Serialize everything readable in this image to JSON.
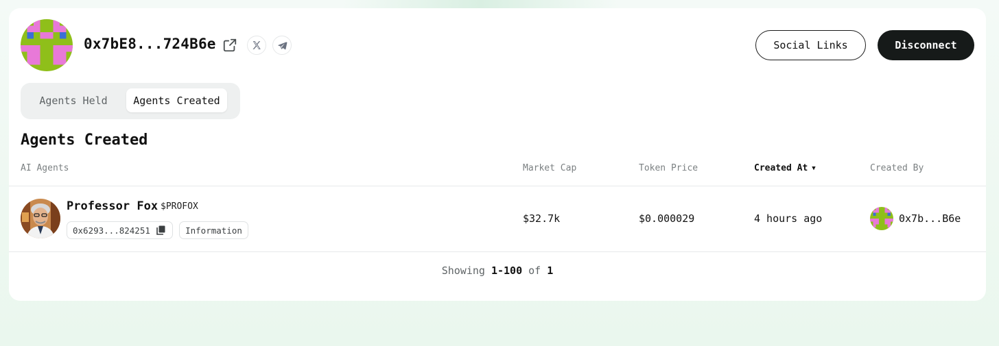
{
  "profile": {
    "address_short": "0x7bE8...724B6e",
    "avatar_colors": {
      "bg": "#8fbf1a",
      "pink": "#e879d8",
      "blue": "#3b6fd6"
    }
  },
  "header": {
    "social_links_label": "Social Links",
    "disconnect_label": "Disconnect"
  },
  "tabs": [
    {
      "label": "Agents Held",
      "active": false
    },
    {
      "label": "Agents Created",
      "active": true
    }
  ],
  "section_title": "Agents Created",
  "table": {
    "columns": [
      "AI Agents",
      "Market Cap",
      "Token Price",
      "Created At",
      "Created By"
    ],
    "sorted_column": "Created At",
    "rows": [
      {
        "name": "Professor Fox",
        "ticker": "$PROFOX",
        "contract": "0x6293...824251",
        "tag": "Information",
        "market_cap": "$32.7k",
        "token_price": "$0.000029",
        "created_at": "4 hours ago",
        "created_by": "0x7b...B6e"
      }
    ]
  },
  "pagination": {
    "prefix": "Showing",
    "range": "1-100",
    "of_label": "of",
    "total": "1"
  },
  "icons": {
    "external": "external-link-icon",
    "x": "x-logo-icon",
    "telegram": "telegram-icon",
    "copy": "copy-icon",
    "sort": "caret-down-icon"
  },
  "colors": {
    "accent_dark": "#161a19",
    "muted_text": "#7b8082",
    "border": "#e7e9ea"
  }
}
